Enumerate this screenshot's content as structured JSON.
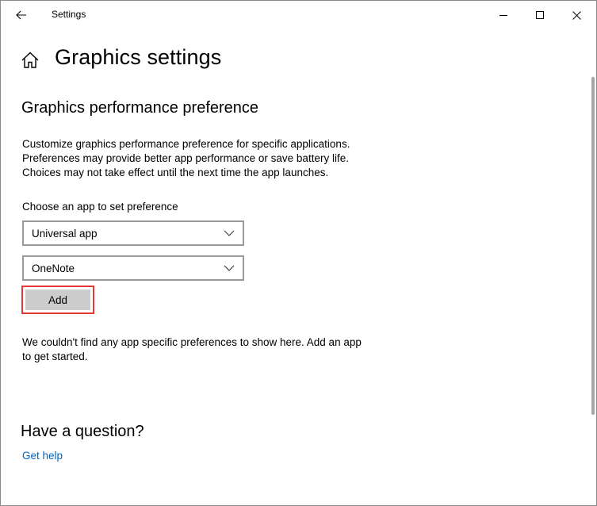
{
  "window": {
    "title": "Settings"
  },
  "header": {
    "page_title": "Graphics settings"
  },
  "section": {
    "title": "Graphics performance preference",
    "description_lines": [
      "Customize graphics performance preference for specific applications.",
      "Preferences may provide better app performance or save battery life.",
      "Choices may not take effect until the next time the app launches."
    ]
  },
  "app_chooser": {
    "label": "Choose an app to set preference",
    "app_type_value": "Universal app",
    "app_value": "OneNote",
    "add_label": "Add"
  },
  "empty_state": {
    "lines": [
      "We couldn't find any app specific preferences to show here. Add an app",
      "to get started."
    ]
  },
  "help": {
    "title": "Have a question?",
    "link_label": "Get help"
  },
  "colors": {
    "link": "#0067c0",
    "highlight": "#e53935",
    "button_bg": "#cccccc",
    "dropdown_border": "#9a9a9a"
  },
  "icons": [
    "back-arrow-icon",
    "minimize-icon",
    "maximize-icon",
    "close-icon",
    "home-icon",
    "chevron-down-icon"
  ]
}
